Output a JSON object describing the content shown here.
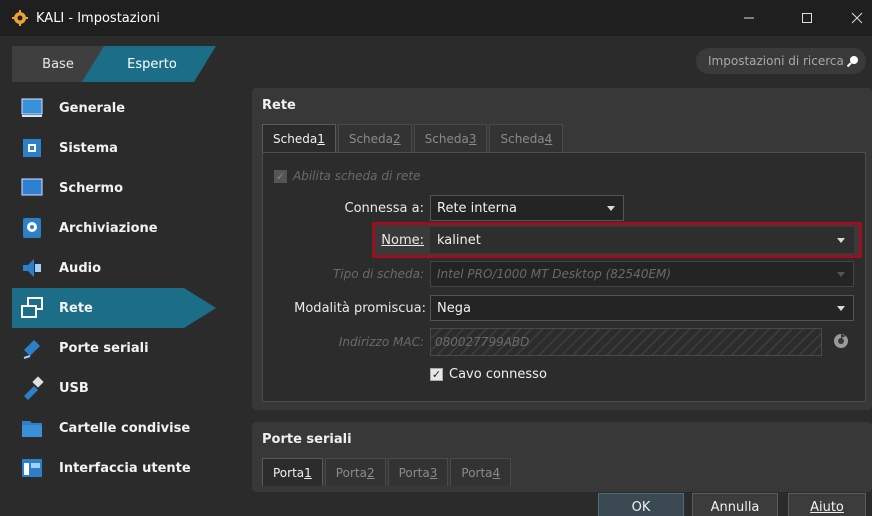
{
  "window": {
    "title": "KALI - Impostazioni"
  },
  "modes": {
    "base": "Base",
    "expert": "Esperto"
  },
  "search": {
    "placeholder": "Impostazioni di ricerca"
  },
  "sidebar": {
    "items": [
      {
        "label": "Generale",
        "icon": "general-icon"
      },
      {
        "label": "Sistema",
        "icon": "system-icon"
      },
      {
        "label": "Schermo",
        "icon": "display-icon"
      },
      {
        "label": "Archiviazione",
        "icon": "storage-icon"
      },
      {
        "label": "Audio",
        "icon": "audio-icon"
      },
      {
        "label": "Rete",
        "icon": "network-icon",
        "selected": true
      },
      {
        "label": "Porte seriali",
        "icon": "serial-ports-icon"
      },
      {
        "label": "USB",
        "icon": "usb-icon"
      },
      {
        "label": "Cartelle condivise",
        "icon": "shared-folders-icon"
      },
      {
        "label": "Interfaccia utente",
        "icon": "user-interface-icon"
      }
    ]
  },
  "network": {
    "section_title": "Rete",
    "tabs": [
      {
        "label_prefix": "Scheda ",
        "label_num": "1",
        "active": true
      },
      {
        "label_prefix": "Scheda ",
        "label_num": "2"
      },
      {
        "label_prefix": "Scheda ",
        "label_num": "3"
      },
      {
        "label_prefix": "Scheda ",
        "label_num": "4"
      }
    ],
    "enable_adapter": {
      "label": "Abilita scheda di rete",
      "checked": true,
      "disabled": true
    },
    "attached_to": {
      "label": "Connessa a:",
      "value": "Rete interna"
    },
    "name": {
      "label": "Nome:",
      "value": "kalinet"
    },
    "adapter_type": {
      "label": "Tipo di scheda:",
      "value": "Intel PRO/1000 MT Desktop (82540EM)"
    },
    "promiscuous": {
      "label": "Modalità promiscua:",
      "value": "Nega"
    },
    "mac": {
      "label": "Indirizzo MAC:",
      "value": "080027799ABD"
    },
    "cable": {
      "label": "Cavo connesso",
      "checked": true
    }
  },
  "serial": {
    "section_title": "Porte seriali",
    "tabs": [
      {
        "label_prefix": "Porta ",
        "label_num": "1",
        "active": true
      },
      {
        "label_prefix": "Porta ",
        "label_num": "2"
      },
      {
        "label_prefix": "Porta ",
        "label_num": "3"
      },
      {
        "label_prefix": "Porta ",
        "label_num": "4"
      }
    ]
  },
  "buttons": {
    "ok": "OK",
    "cancel": "Annulla",
    "help": "Aiuto"
  },
  "colors": {
    "accent": "#1c6e88",
    "highlight_border": "#9a1020",
    "background": "#2b2b2b"
  }
}
